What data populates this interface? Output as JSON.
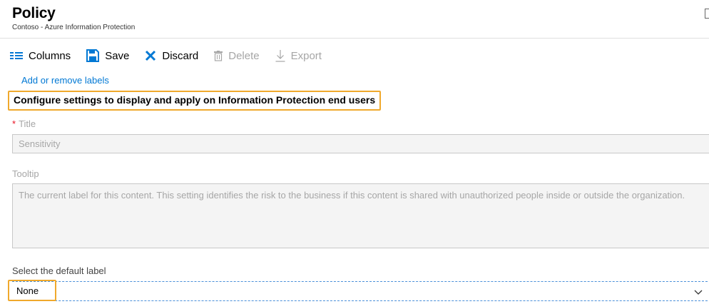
{
  "header": {
    "title": "Policy",
    "subtitle": "Contoso - Azure Information Protection"
  },
  "toolbar": {
    "columns_label": "Columns",
    "save_label": "Save",
    "discard_label": "Discard",
    "delete_label": "Delete",
    "export_label": "Export"
  },
  "content": {
    "add_remove_link": "Add or remove labels",
    "section_heading": "Configure settings to display and apply on Information Protection end users",
    "title_field": {
      "label": "Title",
      "required_marker": "*",
      "value": "Sensitivity"
    },
    "tooltip_field": {
      "label": "Tooltip",
      "value": "The current label for this content. This setting identifies the risk to the business if this content is shared with unauthorized people inside or outside the organization."
    },
    "default_label_field": {
      "label": "Select the default label",
      "value": "None"
    }
  },
  "colors": {
    "accent": "#0078d4",
    "highlight": "#f0a92c",
    "discard": "#0078d4",
    "required": "#e81123"
  },
  "icons": [
    "columns-icon",
    "save-icon",
    "discard-icon",
    "delete-icon",
    "export-icon",
    "chevron-down-icon"
  ]
}
